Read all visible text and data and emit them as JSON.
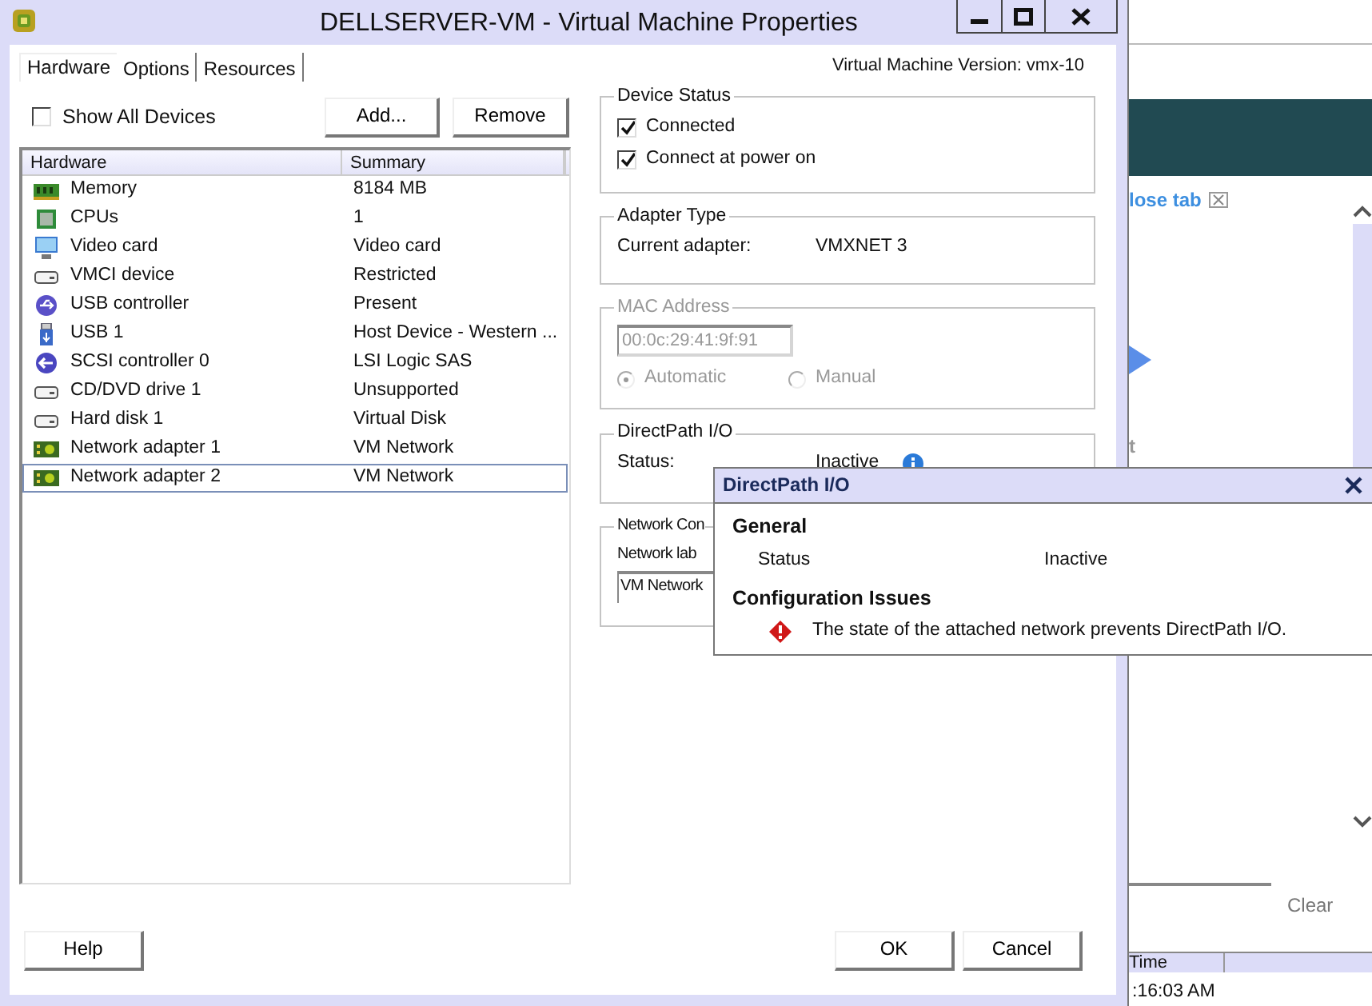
{
  "window": {
    "title": "DELLSERVER-VM - Virtual Machine Properties"
  },
  "tabs": [
    {
      "label": "Hardware",
      "selected": true
    },
    {
      "label": "Options",
      "selected": false
    },
    {
      "label": "Resources",
      "selected": false
    }
  ],
  "version": "Virtual Machine Version: vmx-10",
  "show_all_devices": {
    "label": "Show All Devices",
    "checked": false
  },
  "list_buttons": [
    "Add...",
    "Remove"
  ],
  "device_table": {
    "columns": [
      "Hardware",
      "Summary"
    ],
    "rows": [
      {
        "kind": "memory",
        "name": "Memory",
        "summary": "8184 MB",
        "selected": false
      },
      {
        "kind": "cpu",
        "name": "CPUs",
        "summary": "1",
        "selected": false
      },
      {
        "kind": "monitor",
        "name": "Video card",
        "summary": "Video card",
        "selected": false
      },
      {
        "kind": "drive",
        "name": "VMCI device",
        "summary": "Restricted",
        "selected": false
      },
      {
        "kind": "usb-controller",
        "name": "USB controller",
        "summary": "Present",
        "selected": false
      },
      {
        "kind": "usb",
        "name": "USB 1",
        "summary": "Host Device - Western ...",
        "selected": false
      },
      {
        "kind": "scsi",
        "name": "SCSI controller 0",
        "summary": "LSI Logic SAS",
        "selected": false
      },
      {
        "kind": "drive",
        "name": "CD/DVD drive 1",
        "summary": "Unsupported",
        "selected": false
      },
      {
        "kind": "drive",
        "name": "Hard disk 1",
        "summary": "Virtual Disk",
        "selected": false
      },
      {
        "kind": "network",
        "name": "Network adapter 1",
        "summary": "VM Network",
        "selected": false
      },
      {
        "kind": "network",
        "name": "Network adapter 2",
        "summary": "VM Network",
        "selected": true
      }
    ]
  },
  "device_status": {
    "title": "Device Status",
    "options": [
      {
        "label": "Connected",
        "checked": true
      },
      {
        "label": "Connect at power on",
        "checked": true
      }
    ]
  },
  "adapter_type": {
    "title": "Adapter Type",
    "label": "Current adapter:",
    "value": "VMXNET 3"
  },
  "mac_address": {
    "title": "MAC Address",
    "disabled": true,
    "value": "00:0c:29:41:9f:91",
    "options": [
      {
        "label": "Automatic",
        "selected": true
      },
      {
        "label": "Manual",
        "selected": false
      }
    ]
  },
  "directpath": {
    "title": "DirectPath I/O",
    "label": "Status:",
    "value": "Inactive"
  },
  "network_connection": {
    "title": "Network Con",
    "label": "Network lab",
    "value": "VM Network"
  },
  "footer_buttons": [
    "Help",
    "OK",
    "Cancel"
  ],
  "popup": {
    "title": "DirectPath I/O",
    "general": {
      "heading": "General",
      "label": "Status",
      "value": "Inactive"
    },
    "issues": {
      "heading": "Configuration Issues",
      "items": [
        "The state of the attached network prevents DirectPath I/O."
      ]
    }
  },
  "background_app": {
    "link": "lose tab",
    "partial_text": "t",
    "clear_button": "Clear",
    "table": {
      "columns": [
        "Time"
      ],
      "rows": [
        ":16:03 AM"
      ]
    }
  }
}
